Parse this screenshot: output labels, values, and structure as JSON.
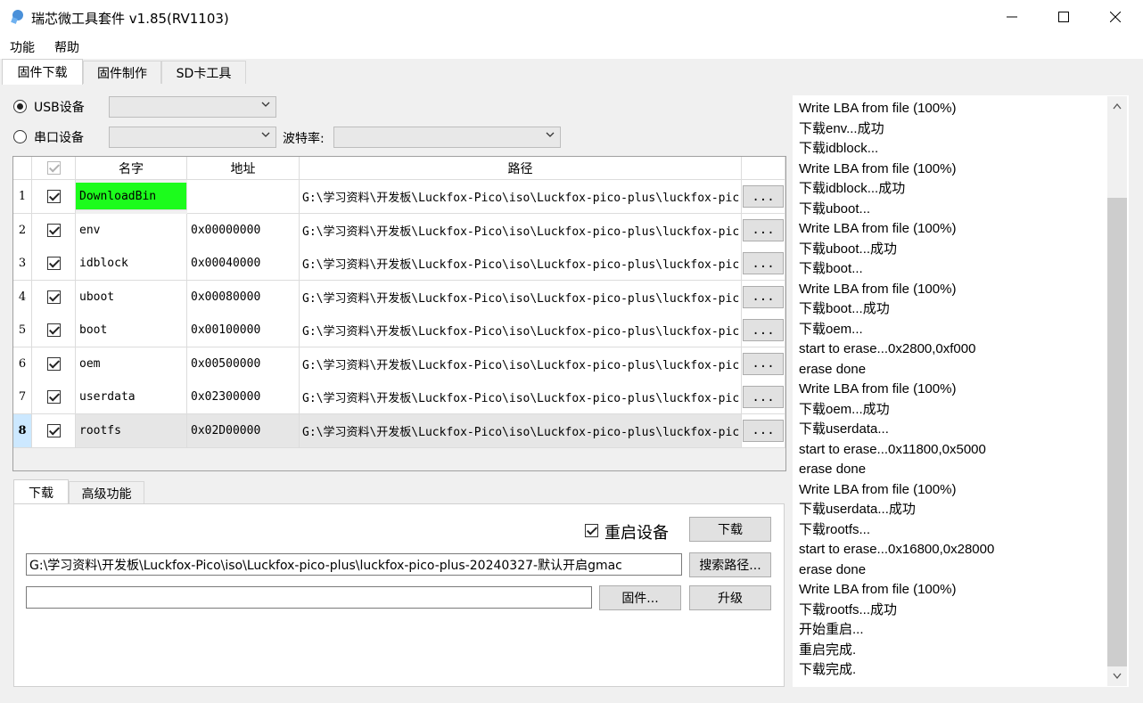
{
  "window": {
    "title": "瑞芯微工具套件 v1.85(RV1103)",
    "minimize": "—",
    "maximize": "☐",
    "close": "✕"
  },
  "menu": [
    "功能",
    "帮助"
  ],
  "tabs": [
    "固件下载",
    "固件制作",
    "SD卡工具"
  ],
  "device": {
    "usb_label": "USB设备",
    "serial_label": "串口设备",
    "baud_label": "波特率:"
  },
  "grid": {
    "headers": [
      "名字",
      "地址",
      "路径"
    ],
    "path_prefix": "G:\\学习资料\\开发板\\Luckfox-Pico\\iso\\Luckfox-pico-plus\\luckfox-pic",
    "browse_label": "...",
    "rows": [
      {
        "num": "1",
        "name": "DownloadBin",
        "addr": ""
      },
      {
        "num": "2",
        "name": "env",
        "addr": "0x00000000"
      },
      {
        "num": "3",
        "name": "idblock",
        "addr": "0x00040000"
      },
      {
        "num": "4",
        "name": "uboot",
        "addr": "0x00080000"
      },
      {
        "num": "5",
        "name": "boot",
        "addr": "0x00100000"
      },
      {
        "num": "6",
        "name": "oem",
        "addr": "0x00500000"
      },
      {
        "num": "7",
        "name": "userdata",
        "addr": "0x02300000"
      },
      {
        "num": "8",
        "name": "rootfs",
        "addr": "0x02D00000"
      }
    ],
    "highlight_color": "#1cfc1c",
    "selected_row_color": "#cce8ff"
  },
  "lower": {
    "tabs": [
      "下载",
      "高级功能"
    ],
    "reboot_label": "重启设备",
    "download_button": "下载",
    "path_value": "G:\\学习资料\\开发板\\Luckfox-Pico\\iso\\Luckfox-pico-plus\\luckfox-pico-plus-20240327-默认开启gmac",
    "search_button": "搜索路径...",
    "firmware_value": "",
    "firmware_button": "固件...",
    "upgrade_button": "升级"
  },
  "log": [
    "Write LBA from file (100%)",
    "下载env...成功",
    "下载idblock...",
    "Write LBA from file (100%)",
    "下载idblock...成功",
    "下载uboot...",
    "Write LBA from file (100%)",
    "下载uboot...成功",
    "下载boot...",
    "Write LBA from file (100%)",
    "下载boot...成功",
    "下载oem...",
    "start to erase...0x2800,0xf000",
    "erase done",
    "Write LBA from file (100%)",
    "下载oem...成功",
    "下载userdata...",
    "start to erase...0x11800,0x5000",
    "erase done",
    "Write LBA from file (100%)",
    "下载userdata...成功",
    "下载rootfs...",
    "start to erase...0x16800,0x28000",
    "erase done",
    "Write LBA from file (100%)",
    "下载rootfs...成功",
    "开始重启...",
    "重启完成.",
    "下载完成."
  ],
  "icons": {
    "app": "app-icon",
    "scroll_up": "▲",
    "scroll_down": "▼",
    "dropdown": "⌄"
  }
}
